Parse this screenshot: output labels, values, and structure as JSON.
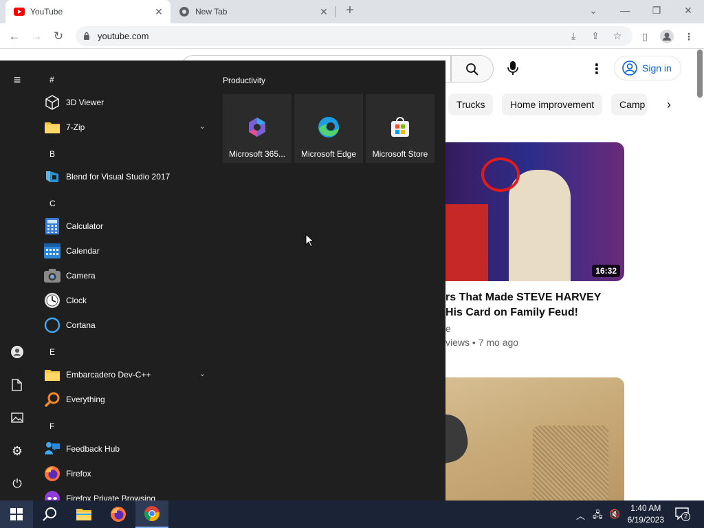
{
  "browser": {
    "tabs": [
      {
        "label": "YouTube",
        "active": true
      },
      {
        "label": "New Tab",
        "active": false
      }
    ],
    "new_tab_symbol": "+",
    "url": "youtube.com"
  },
  "youtube": {
    "sign_in": "Sign in",
    "chips": [
      "Trucks",
      "Home improvement",
      "Camp"
    ],
    "videos": [
      {
        "duration": "16:32",
        "title_line1": "rs That Made STEVE HARVEY",
        "title_line2": "His Card on Family Feud!",
        "channel": "e",
        "meta": "views • 7 mo ago"
      }
    ]
  },
  "start_menu": {
    "sections": [
      {
        "letter": "#",
        "apps": [
          {
            "name": "3D Viewer",
            "icon": "cube-icon"
          },
          {
            "name": "7-Zip",
            "icon": "folder-icon",
            "expandable": true
          }
        ]
      },
      {
        "letter": "B",
        "apps": [
          {
            "name": "Blend for Visual Studio 2017",
            "icon": "blend-icon"
          }
        ]
      },
      {
        "letter": "C",
        "apps": [
          {
            "name": "Calculator",
            "icon": "calculator-icon"
          },
          {
            "name": "Calendar",
            "icon": "calendar-icon"
          },
          {
            "name": "Camera",
            "icon": "camera-icon"
          },
          {
            "name": "Clock",
            "icon": "clock-icon"
          },
          {
            "name": "Cortana",
            "icon": "cortana-icon"
          }
        ]
      },
      {
        "letter": "E",
        "apps": [
          {
            "name": "Embarcadero Dev-C++",
            "icon": "folder-icon",
            "expandable": true
          },
          {
            "name": "Everything",
            "icon": "search-icon"
          }
        ]
      },
      {
        "letter": "F",
        "apps": [
          {
            "name": "Feedback Hub",
            "icon": "feedback-icon"
          },
          {
            "name": "Firefox",
            "icon": "firefox-icon"
          },
          {
            "name": "Firefox Private Browsing",
            "icon": "firefox-private-icon"
          }
        ]
      }
    ],
    "group_title": "Productivity",
    "tiles": [
      {
        "label": "Microsoft 365...",
        "icon": "m365-icon"
      },
      {
        "label": "Microsoft Edge",
        "icon": "edge-icon"
      },
      {
        "label": "Microsoft Store",
        "icon": "store-icon"
      }
    ]
  },
  "taskbar": {
    "time": "1:40 AM",
    "date": "6/19/2023",
    "notification_count": "2"
  }
}
